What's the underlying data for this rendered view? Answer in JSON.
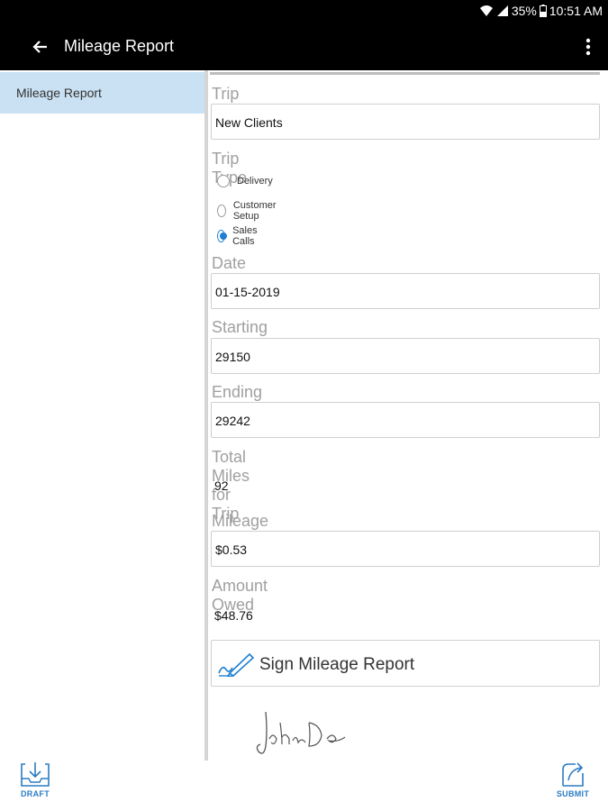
{
  "status": {
    "battery": "35%",
    "time": "10:51 AM"
  },
  "appbar": {
    "title": "Mileage Report"
  },
  "sidebar": {
    "items": [
      {
        "label": "Mileage Report"
      }
    ]
  },
  "form": {
    "trip_name": {
      "label": "Trip Name",
      "value": "New Clients"
    },
    "trip_type": {
      "label": "Trip Type",
      "options": [
        "Delivery",
        "Customer Setup",
        "Sales Calls"
      ],
      "selected": "Sales Calls"
    },
    "date": {
      "label": "Date",
      "value": "01-15-2019"
    },
    "starting_odometer": {
      "label": "Starting Odometer",
      "value": "29150"
    },
    "ending_odometer": {
      "label": "Ending Odometer",
      "value": "29242"
    },
    "total_miles": {
      "label": "Total Miles for Trip",
      "value": "92"
    },
    "reimbursement_rate": {
      "label": "Mileage Reimbursement Rate",
      "value": "$0.53"
    },
    "amount_owed": {
      "label": "Amount Owed",
      "value": "$48.76"
    },
    "sign_button": {
      "label": "Sign Mileage Report"
    },
    "signature": {
      "text": "John Doe"
    }
  },
  "bottombar": {
    "draft_label": "DRAFT",
    "submit_label": "SUBMIT"
  },
  "colors": {
    "accent": "#1f7fd1",
    "sidebar_selected": "#c9e1f2",
    "appbar": "#000000"
  }
}
